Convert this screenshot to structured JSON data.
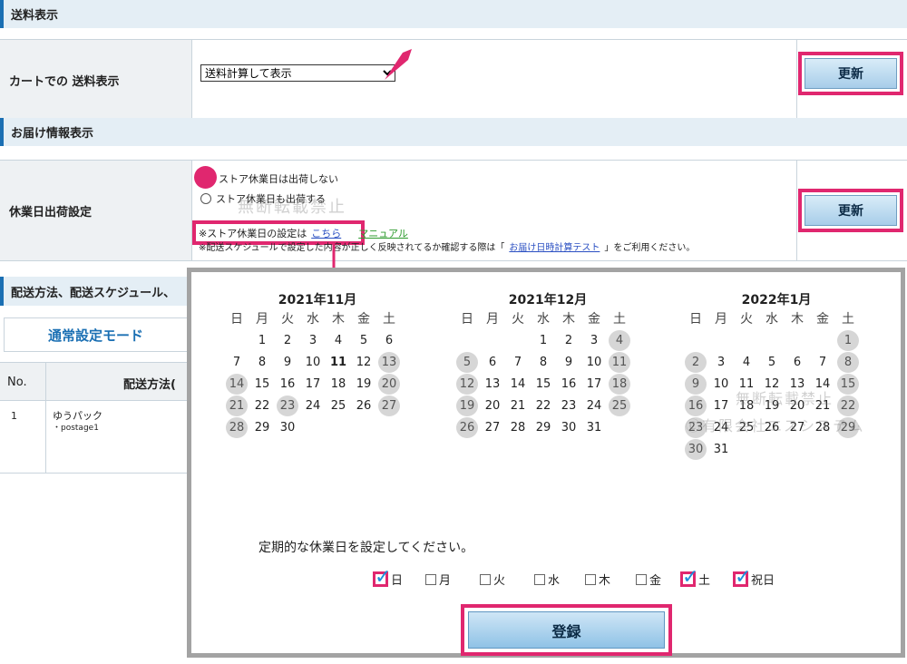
{
  "sections": {
    "shipping_display": "送料表示",
    "delivery_info": "お届け情報表示",
    "delivery_method": "配送方法、配送スケジュール、"
  },
  "cart_shipping": {
    "label": "カートでの 送料表示",
    "select_value": "送料計算して表示",
    "update_label": "更新"
  },
  "holiday_shipping": {
    "label": "休業日出荷設定",
    "option_no_ship": "ストア休業日は出荷しない",
    "option_ship": "ストア休業日も出荷する",
    "setting_prefix": "※ストア休業日の設定は",
    "setting_link": "こちら",
    "manual_link": "マニュアル",
    "note_prefix": "※配送スケジュールで設定した内容が正しく反映されてるか確認する際は「",
    "note_link": "お届け日時計算テスト",
    "note_suffix": "」をご利用ください。",
    "update_label": "更新"
  },
  "mode_tab": "通常設定モード",
  "table": {
    "col_no": "No.",
    "col_method": "配送方法(",
    "row_no": "1",
    "row_name": "ゆうパック",
    "row_sub": "・postage1"
  },
  "calendar": {
    "weekdays": [
      "日",
      "月",
      "火",
      "水",
      "木",
      "金",
      "土"
    ],
    "months": [
      {
        "title": "2021年11月",
        "start": 1,
        "days": 30,
        "holidays": [
          13,
          14,
          20,
          21,
          23,
          27,
          28
        ],
        "today": 11
      },
      {
        "title": "2021年12月",
        "start": 3,
        "days": 31,
        "holidays": [
          4,
          5,
          11,
          12,
          18,
          19,
          25,
          26
        ],
        "today": 0
      },
      {
        "title": "2022年1月",
        "start": 6,
        "days": 31,
        "holidays": [
          1,
          2,
          8,
          9,
          15,
          16,
          22,
          23,
          29,
          30
        ],
        "today": 0
      }
    ],
    "prompt": "定期的な休業日を設定してください。",
    "day_checks": [
      {
        "label": "日",
        "checked": true
      },
      {
        "label": "月",
        "checked": false
      },
      {
        "label": "火",
        "checked": false
      },
      {
        "label": "水",
        "checked": false
      },
      {
        "label": "木",
        "checked": false
      },
      {
        "label": "金",
        "checked": false
      },
      {
        "label": "土",
        "checked": true
      },
      {
        "label": "祝日",
        "checked": true
      }
    ],
    "register_label": "登録"
  },
  "watermarks": [
    "無断転載禁止",
    "Ⓒ有限会社エスシステム"
  ],
  "colors": {
    "highlight": "#e0276f",
    "accent": "#1a6fb3",
    "check": "#1d8ddb"
  }
}
